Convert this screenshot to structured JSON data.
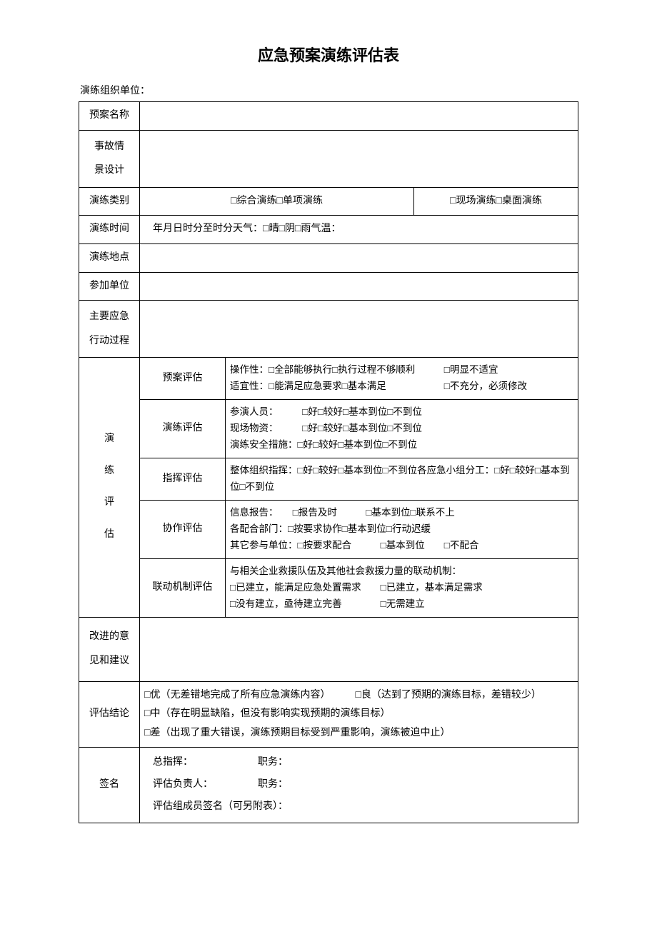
{
  "title": "应急预案演练评估表",
  "org_label": "演练组织单位：",
  "labels": {
    "plan_name": "预案名称",
    "scenario": "事故情\n景设计",
    "category": "演练类别",
    "time": "演练时间",
    "location": "演练地点",
    "units": "参加单位",
    "process": "主要应急\n行动过程",
    "evaluation": "演\n练\n评\n估",
    "improve": "改进的意\n见和建议",
    "conclusion": "评估结论",
    "signature": "签名"
  },
  "category_a": "□综合演练□单项演练",
  "category_b": "□现场演练□桌面演练",
  "time_content": "年月日时分至时分天气：□晴□阴□雨气温：",
  "eval_rows": {
    "plan": {
      "label": "预案评估",
      "content": "操作性：□全部能够执行□执行过程不够顺利　　　□明显不适宜\n适宜性：□能满足应急要求□基本满足　　　　　　□不充分，必须修改"
    },
    "drill": {
      "label": "演练评估",
      "content": "参演人员：　　　□好□较好□基本到位□不到位\n现场物资：　　　□好□较好□基本到位□不到位\n演练安全措施：□好□较好□基本到位□不到位"
    },
    "command": {
      "label": "指挥评估",
      "content": "整体组织指挥：□好□较好□基本到位□不到位各应急小组分工：□好□较好□基本到位□不到位"
    },
    "coop": {
      "label": "协作评估",
      "content": "信息报告：　　□报告及时　　　□基本到位□联系不上\n各配合部门：□按要求协作□基本到位□行动迟缓\n其它参与单位：□按要求配合　　　□基本到位　　□不配合"
    },
    "link": {
      "label": "联动机制评估",
      "content": "与相关企业救援队伍及其他社会救援力量的联动机制：\n□已建立，能满足应急处置需求　　□已建立，基本满足需求\n□没有建立，亟待建立完善　　　　□无需建立"
    }
  },
  "conclusion_content": "□优（无差错地完成了所有应急演练内容）　　　□良（达到了预期的演练目标，差错较少）\n□中（存在明显缺陷，但没有影响实现预期的演练目标）\n□差（出现了重大错误，演练预期目标受到严重影响，演练被迫中止）",
  "signature_content": "总指挥：　　　　　　　职务：\n评估负责人：　　　　　职务：\n评估组成员签名（可另附表）："
}
